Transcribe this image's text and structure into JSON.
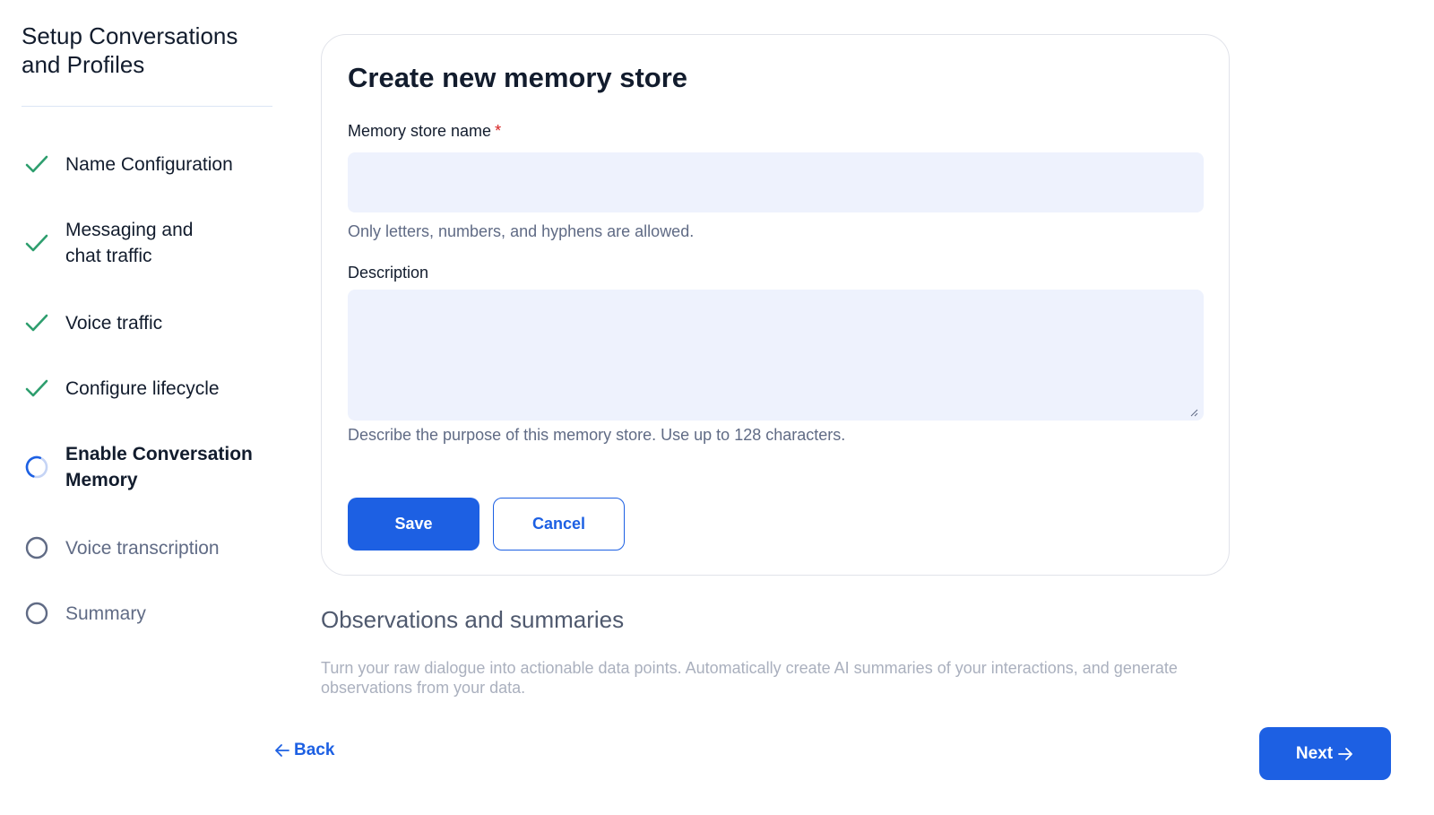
{
  "sidebar": {
    "title": "Setup Conversations and Profiles",
    "steps": [
      {
        "label": "Name Configuration",
        "status": "complete",
        "icon": "check-icon"
      },
      {
        "label": "Messaging and chat traffic",
        "status": "complete",
        "icon": "check-icon"
      },
      {
        "label": "Voice traffic",
        "status": "complete",
        "icon": "check-icon"
      },
      {
        "label": "Configure lifecycle",
        "status": "complete",
        "icon": "check-icon"
      },
      {
        "label": "Enable Conversation Memory",
        "status": "current",
        "icon": "in-progress-icon"
      },
      {
        "label": "Voice transcription",
        "status": "pending",
        "icon": "empty-circle-icon"
      },
      {
        "label": "Summary",
        "status": "pending",
        "icon": "empty-circle-icon"
      }
    ]
  },
  "form": {
    "title": "Create new memory store",
    "name_label": "Memory store name",
    "required_marker": "*",
    "name_value": "",
    "name_help": "Only letters, numbers, and hyphens are allowed.",
    "description_label": "Description",
    "description_value": "",
    "description_help": "Describe the purpose of this memory store. Use up to 128 characters.",
    "save_label": "Save",
    "cancel_label": "Cancel"
  },
  "section": {
    "heading": "Observations and summaries",
    "text": "Turn your raw dialogue into actionable data points. Automatically create AI summaries of your interactions, and generate observations from your data."
  },
  "footer": {
    "back_label": "Back",
    "next_label": "Next"
  },
  "colors": {
    "accent": "#1d60e3",
    "complete": "#2e9e6e",
    "pending": "#606b85",
    "input_bg": "#eef2fd",
    "required": "#d61f1f"
  }
}
